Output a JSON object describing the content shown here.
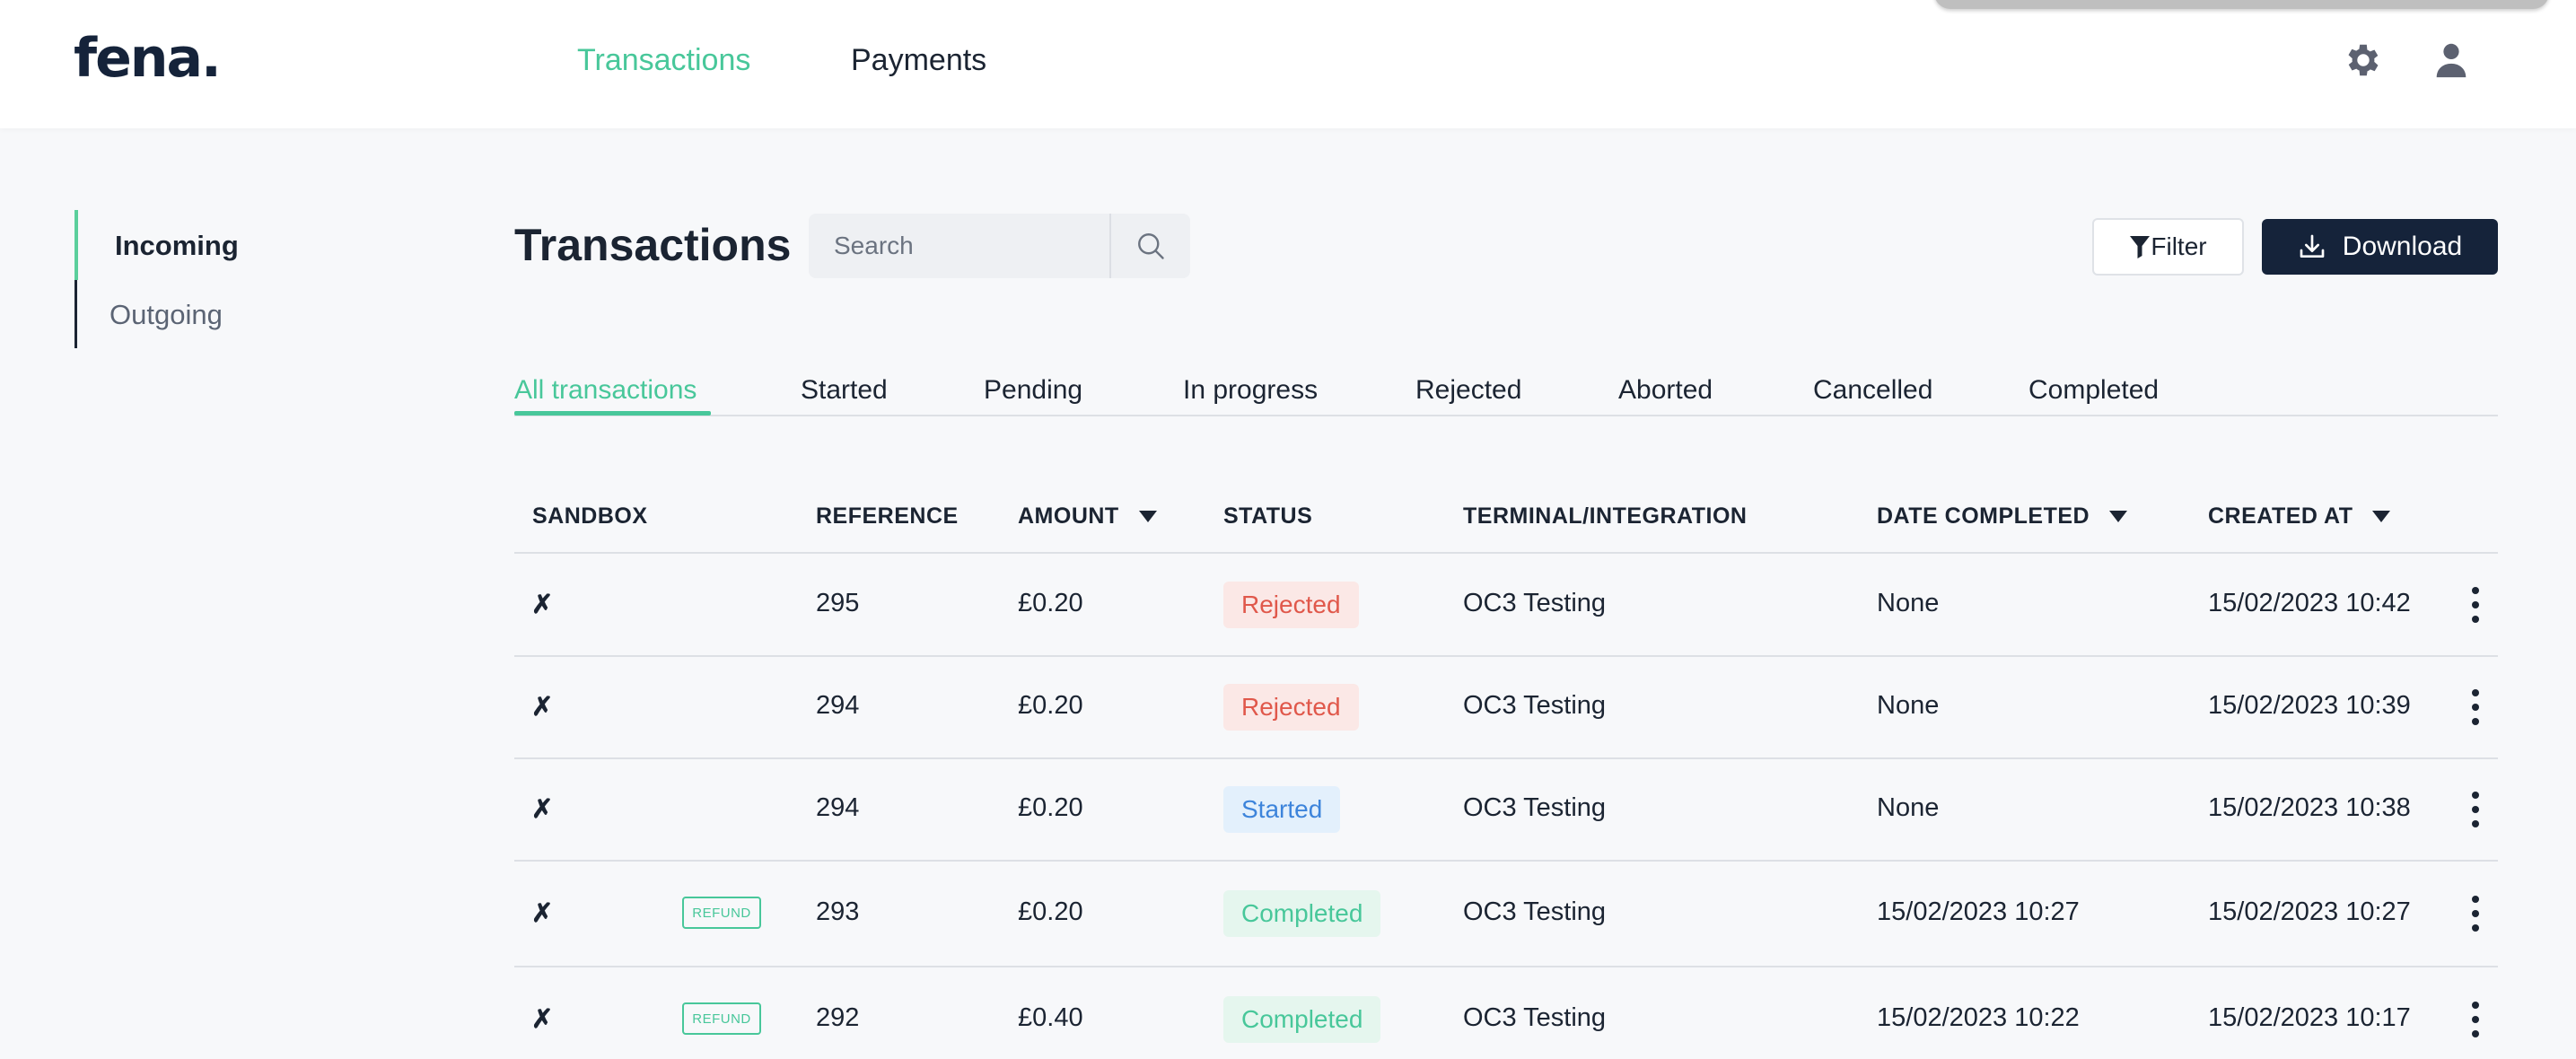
{
  "header": {
    "logo": "fena.",
    "nav": [
      {
        "label": "Transactions",
        "active": true
      },
      {
        "label": "Payments",
        "active": false
      }
    ],
    "icons": [
      "gear-icon",
      "user-icon"
    ]
  },
  "sidebar": {
    "items": [
      {
        "label": "Incoming",
        "active": true
      },
      {
        "label": "Outgoing",
        "active": false
      }
    ]
  },
  "main": {
    "title": "Transactions",
    "search": {
      "placeholder": "Search"
    },
    "filter_label": "Filter",
    "download_label": "Download",
    "tabs": [
      {
        "label": "All transactions",
        "active": true
      },
      {
        "label": "Started"
      },
      {
        "label": "Pending"
      },
      {
        "label": "In progress"
      },
      {
        "label": "Rejected"
      },
      {
        "label": "Aborted"
      },
      {
        "label": "Cancelled"
      },
      {
        "label": "Completed"
      }
    ],
    "columns": {
      "sandbox": "SANDBOX",
      "reference": "REFERENCE",
      "amount": "AMOUNT",
      "status": "STATUS",
      "terminal": "TERMINAL/INTEGRATION",
      "date_completed": "DATE COMPLETED",
      "created_at": "CREATED AT"
    },
    "rows": [
      {
        "sandbox": "✗",
        "refund": "",
        "reference": "295",
        "amount": "£0.20",
        "status": "Rejected",
        "terminal": "OC3 Testing",
        "date_completed": "None",
        "created_at": "15/02/2023 10:42"
      },
      {
        "sandbox": "✗",
        "refund": "",
        "reference": "294",
        "amount": "£0.20",
        "status": "Rejected",
        "terminal": "OC3 Testing",
        "date_completed": "None",
        "created_at": "15/02/2023 10:39"
      },
      {
        "sandbox": "✗",
        "refund": "",
        "reference": "294",
        "amount": "£0.20",
        "status": "Started",
        "terminal": "OC3 Testing",
        "date_completed": "None",
        "created_at": "15/02/2023 10:38"
      },
      {
        "sandbox": "✗",
        "refund": "REFUND",
        "reference": "293",
        "amount": "£0.20",
        "status": "Completed",
        "terminal": "OC3 Testing",
        "date_completed": "15/02/2023 10:27",
        "created_at": "15/02/2023 10:27"
      },
      {
        "sandbox": "✗",
        "refund": "REFUND",
        "reference": "292",
        "amount": "£0.40",
        "status": "Completed",
        "terminal": "OC3 Testing",
        "date_completed": "15/02/2023 10:22",
        "created_at": "15/02/2023 10:17"
      }
    ]
  },
  "colors": {
    "accent": "#48c79a",
    "navy": "#15233a",
    "rejected": "#e0584b",
    "started": "#3d84db"
  }
}
